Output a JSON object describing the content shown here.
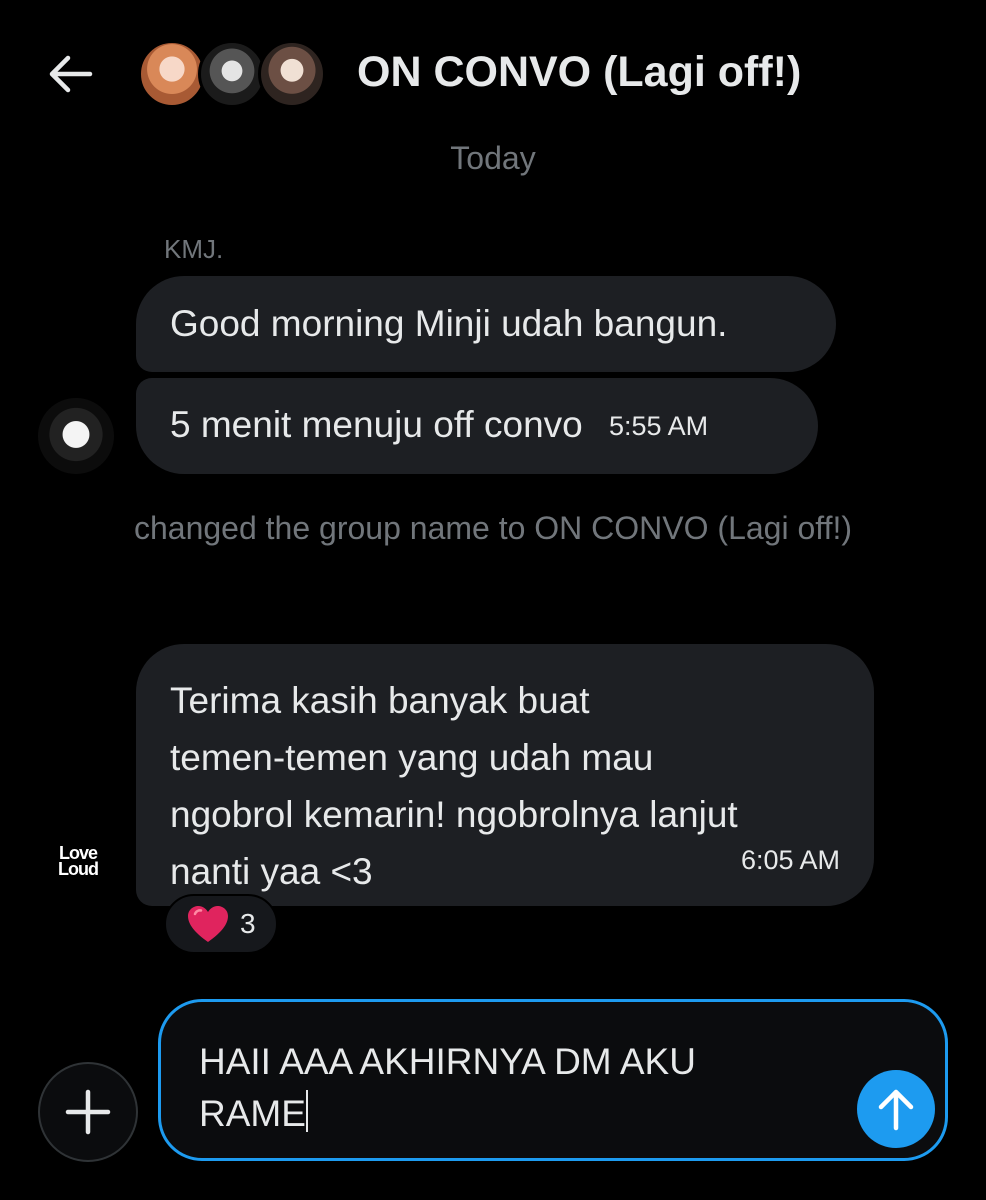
{
  "header": {
    "title": "ON CONVO (Lagi off!)",
    "back_icon": "arrow-left-icon",
    "participants": [
      "participant-1",
      "participant-2",
      "participant-3"
    ]
  },
  "conversation": {
    "date_divider": "Today",
    "group_1": {
      "sender": "KMJ.",
      "messages": [
        {
          "text": "Good morning Minji udah bangun."
        },
        {
          "text": "5 menit menuju off convo",
          "time": "5:55 AM"
        }
      ]
    },
    "system_event": "changed the group name to ON CONVO (Lagi off!)",
    "group_2": {
      "avatar_text": [
        "Love",
        "Loud"
      ],
      "message": {
        "lines": [
          "Terima kasih banyak buat",
          "temen-temen yang udah mau",
          "ngobrol kemarin! ngobrolnya lanjut",
          "nanti yaa <3"
        ],
        "time": "6:05 AM"
      },
      "reaction": {
        "emoji": "heart-icon",
        "count": "3",
        "color": "#e0245e"
      }
    }
  },
  "composer": {
    "lines": [
      "HAII AAA AKHIRNYA DM AKU",
      "RAME"
    ],
    "add_icon": "plus-icon",
    "send_icon": "arrow-up-icon",
    "accent": "#1d9bf0"
  },
  "colors": {
    "background": "#000000",
    "bubble": "#1d1f23",
    "text": "#e7e9ea",
    "muted": "#71767b"
  }
}
